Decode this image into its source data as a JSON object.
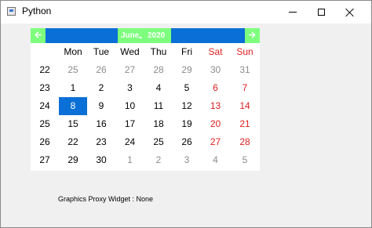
{
  "window": {
    "title": "Python",
    "icons": {
      "app": "app-window-icon",
      "minimize": "minimize-icon",
      "maximize": "maximize-icon",
      "close": "close-icon"
    }
  },
  "calendar": {
    "month": "June",
    "year": "2020",
    "prev_icon": "arrow-left-icon",
    "next_icon": "arrow-right-icon",
    "colors": {
      "nav_bar": "#0a6fd6",
      "nav_buttons": "#7dff7d",
      "weekend": "#e02020",
      "selected": "#0a6fd6",
      "other_month": "#8c8c8c"
    },
    "weekdays": [
      "Mon",
      "Tue",
      "Wed",
      "Thu",
      "Fri",
      "Sat",
      "Sun"
    ],
    "weeks": [
      {
        "week": "22",
        "days": [
          "25",
          "26",
          "27",
          "28",
          "29",
          "30",
          "31"
        ]
      },
      {
        "week": "23",
        "days": [
          "1",
          "2",
          "3",
          "4",
          "5",
          "6",
          "7"
        ]
      },
      {
        "week": "24",
        "days": [
          "8",
          "9",
          "10",
          "11",
          "12",
          "13",
          "14"
        ]
      },
      {
        "week": "25",
        "days": [
          "15",
          "16",
          "17",
          "18",
          "19",
          "20",
          "21"
        ]
      },
      {
        "week": "26",
        "days": [
          "22",
          "23",
          "24",
          "25",
          "26",
          "27",
          "28"
        ]
      },
      {
        "week": "27",
        "days": [
          "29",
          "30",
          "1",
          "2",
          "3",
          "4",
          "5"
        ]
      }
    ],
    "selected_date": "8"
  },
  "proxy_label": "Graphics Proxy Widget : None"
}
